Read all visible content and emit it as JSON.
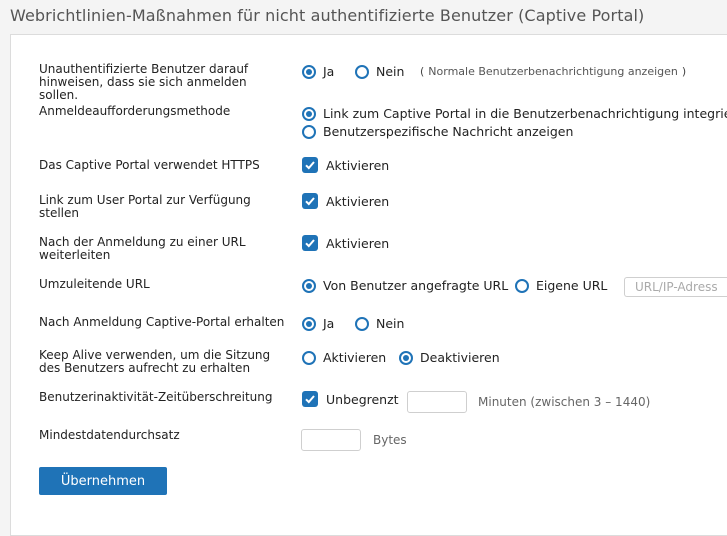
{
  "page": {
    "title": "Webrichtlinien-Maßnahmen für nicht authentifizierte Benutzer (Captive Portal)"
  },
  "rows": {
    "unauth_notify": {
      "label": "Unauthentifizierte Benutzer darauf hinweisen, dass sie sich anmelden sollen.",
      "yes": "Ja",
      "no": "Nein",
      "selected": "yes",
      "paren_open": "(",
      "link": "Normale Benutzerbenachrichtigung anzeigen",
      "paren_close": ")"
    },
    "login_method": {
      "label": "Anmeldeaufforderungsmethode",
      "option1": "Link zum Captive Portal in die Benutzerbenachrichtigung integrieren",
      "option2": "Benutzerspezifische Nachricht anzeigen",
      "selected": "option1"
    },
    "https": {
      "label": "Das Captive Portal verwendet HTTPS",
      "checkbox": "Aktivieren",
      "checked": true
    },
    "user_portal_link": {
      "label": "Link zum User Portal zur Verfügung stellen",
      "checkbox": "Aktivieren",
      "checked": true
    },
    "redirect_after_login": {
      "label": "Nach der Anmeldung zu einer URL weiterleiten",
      "checkbox": "Aktivieren",
      "checked": true
    },
    "redirect_url": {
      "label": "Umzuleitende URL",
      "option1": "Von Benutzer angefragte URL",
      "option2": "Eigene URL",
      "selected": "option1",
      "input_placeholder": "URL/IP-Adresse"
    },
    "keep_portal": {
      "label": "Nach Anmeldung Captive-Portal erhalten",
      "yes": "Ja",
      "no": "Nein",
      "selected": "yes"
    },
    "keep_alive": {
      "label": "Keep Alive verwenden, um die Sitzung des Benutzers aufrecht zu erhalten",
      "option1": "Aktivieren",
      "option2": "Deaktivieren",
      "selected": "option2"
    },
    "inactivity_timeout": {
      "label": "Benutzerinaktivität-Zeitüberschreitung",
      "checkbox": "Unbegrenzt",
      "checked": true,
      "input_value": "",
      "hint": "Minuten (zwischen 3 – 1440)"
    },
    "min_throughput": {
      "label": "Mindestdatendurchsatz",
      "input_value": "",
      "unit": "Bytes"
    }
  },
  "actions": {
    "apply_label": "Übernehmen"
  },
  "colors": {
    "accent": "#1f73b7"
  }
}
